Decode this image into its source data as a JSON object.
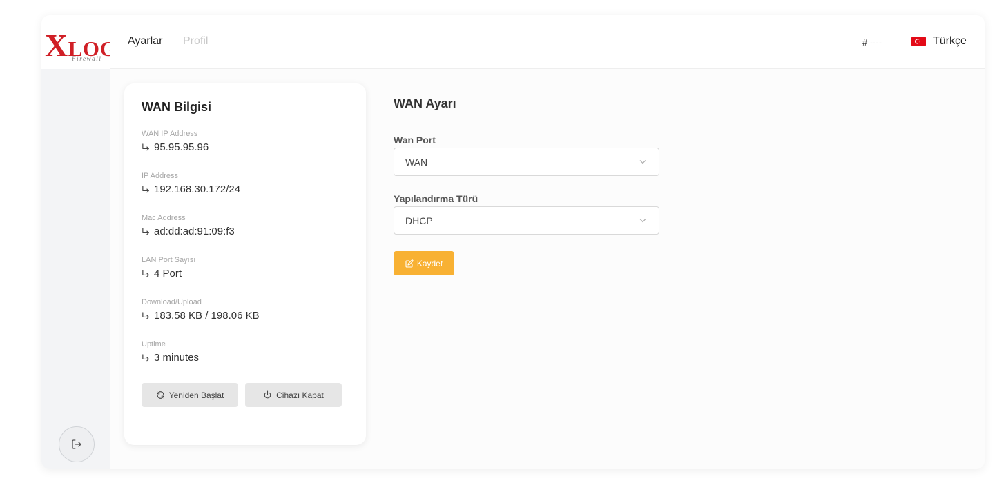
{
  "logo": {
    "brand_x": "X",
    "brand_log": "LOG",
    "subtitle": "Firewall"
  },
  "header": {
    "tabs": [
      {
        "label": "Ayarlar",
        "active": true
      },
      {
        "label": "Profil",
        "active": false
      }
    ],
    "device_id": "# ----",
    "language": {
      "label": "Türkçe",
      "flag": "turkey-flag-icon"
    }
  },
  "wan_info": {
    "title": "WAN Bilgisi",
    "items": [
      {
        "label": "WAN IP Address",
        "value": "95.95.95.96"
      },
      {
        "label": "IP Address",
        "value": "192.168.30.172/24"
      },
      {
        "label": "Mac Address",
        "value": "ad:dd:ad:91:09:f3"
      },
      {
        "label": "LAN Port Sayısı",
        "value": "4 Port"
      },
      {
        "label": "Download/Upload",
        "value": "183.58 KB / 198.06 KB"
      },
      {
        "label": "Uptime",
        "value": "3 minutes"
      }
    ],
    "restart_label": "Yeniden Başlat",
    "shutdown_label": "Cihazı Kapat"
  },
  "wan_settings": {
    "title": "WAN Ayarı",
    "wan_port": {
      "label": "Wan Port",
      "value": "WAN"
    },
    "config_type": {
      "label": "Yapılandırma Türü",
      "value": "DHCP"
    },
    "save_label": "Kaydet"
  },
  "colors": {
    "brand_red": "#d01f26",
    "save_button": "#f8b133",
    "secondary_button": "#e6e6e6",
    "sidebar": "#f3f4f6"
  },
  "icons": {
    "logout": "logout-icon",
    "arrow": "return-arrow-icon",
    "restart": "refresh-icon",
    "shutdown": "power-icon",
    "save": "edit-icon",
    "dropdown": "chevron-down-icon"
  }
}
